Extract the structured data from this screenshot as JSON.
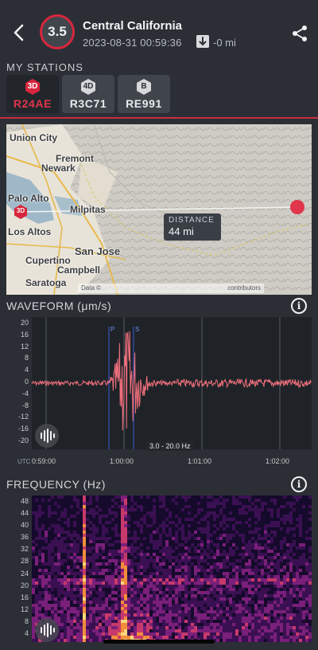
{
  "event": {
    "magnitude": "3.5",
    "title": "Central California",
    "datetime": "2023-08-31 00:59:36",
    "distance": "-0 mi"
  },
  "stations": {
    "label": "MY STATIONS",
    "items": [
      {
        "badge": "3D",
        "name": "R24AE",
        "active": true,
        "badge_color": "#d7263d"
      },
      {
        "badge": "4D",
        "name": "R3C71",
        "active": false,
        "badge_color": "#d6d8da"
      },
      {
        "badge": "B",
        "name": "RE991",
        "active": false,
        "badge_color": "#d6d8da"
      }
    ]
  },
  "map": {
    "labels": [
      "Union City",
      "Fremont",
      "Newark",
      "Palo Alto",
      "Milpitas",
      "Los Altos",
      "San Jose",
      "Cupertino",
      "Campbell",
      "Saratoga"
    ],
    "station_marker": "3D",
    "distance_label": "DISTANCE",
    "distance_value": "44 mi",
    "attribution_left": "Data ©",
    "attribution_right": "contributors"
  },
  "waveform": {
    "title": "WAVEFORM (μm/s)",
    "y_ticks": [
      "20",
      "16",
      "12",
      "8",
      "4",
      "0",
      "-4",
      "-8",
      "-12",
      "-16",
      "-20"
    ],
    "x_ticks": [
      "0:59:00",
      "1:00:00",
      "1:01:00",
      "1:02:00"
    ],
    "utc_label": "UTC",
    "band": "3.0 - 20.0 Hz",
    "phase_p": "P",
    "phase_s": "S"
  },
  "frequency": {
    "title": "FREQUENCY (Hz)",
    "y_ticks": [
      "48",
      "44",
      "40",
      "36",
      "32",
      "28",
      "24",
      "20",
      "16",
      "12",
      "8",
      "4"
    ]
  },
  "colors": {
    "accent": "#d7263d",
    "waveform_line": "#f0707c",
    "background": "#2b2f35"
  }
}
